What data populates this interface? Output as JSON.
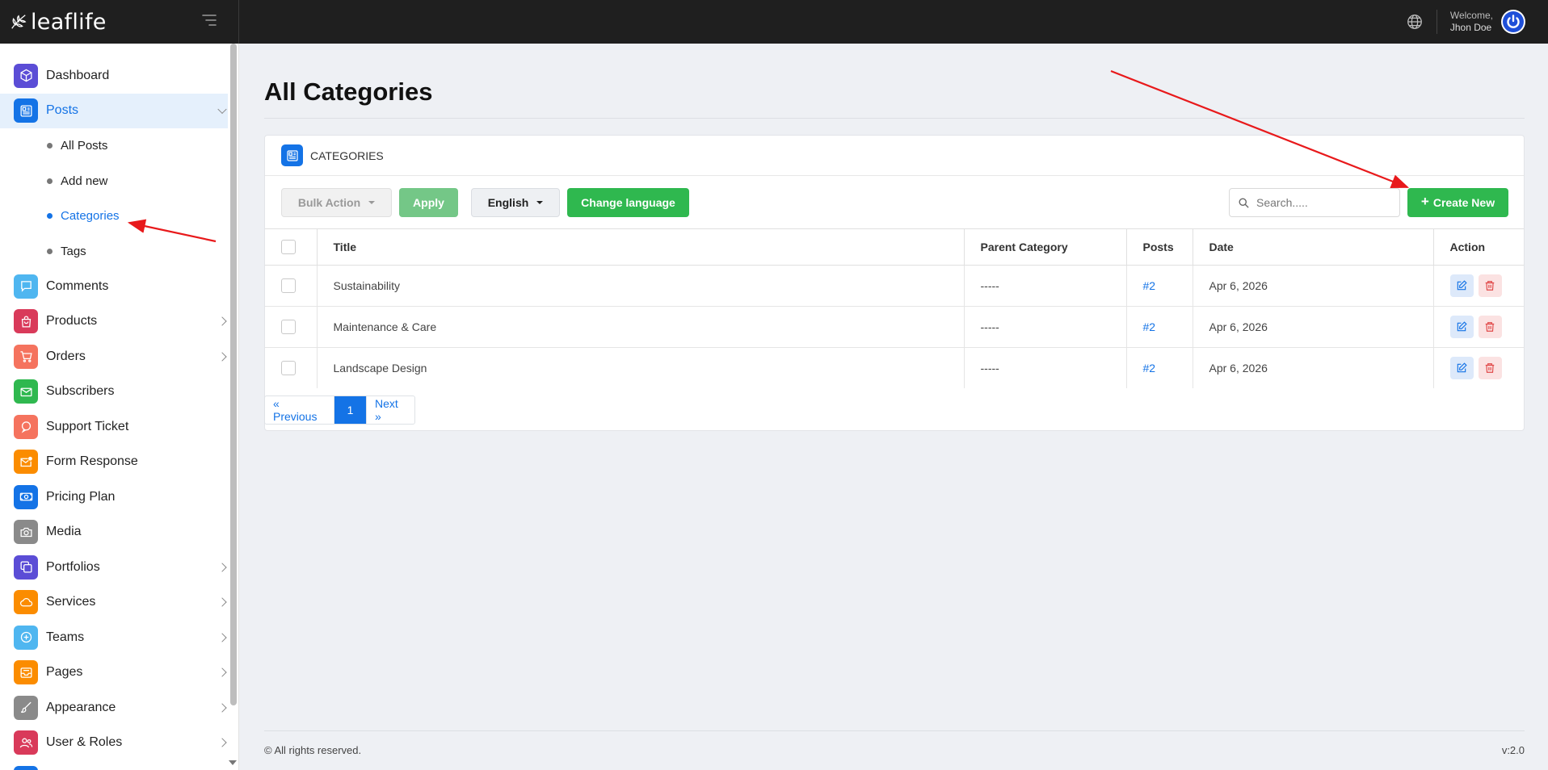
{
  "app": {
    "brand": "leaflife",
    "welcome_label": "Welcome,",
    "user_name": "Jhon Doe"
  },
  "sidebar": {
    "items": [
      {
        "label": "Dashboard",
        "icon": "cube-icon",
        "color": "#5b4dd6"
      },
      {
        "label": "Posts",
        "icon": "newspaper-icon",
        "color": "#1473e6",
        "active": true,
        "expanded": true,
        "children": [
          {
            "label": "All Posts"
          },
          {
            "label": "Add new"
          },
          {
            "label": "Categories",
            "active": true
          },
          {
            "label": "Tags"
          }
        ]
      },
      {
        "label": "Comments",
        "icon": "chat-icon",
        "color": "#4fb6f0"
      },
      {
        "label": "Products",
        "icon": "shopping-bag-icon",
        "color": "#d93a5a",
        "has_children": true
      },
      {
        "label": "Orders",
        "icon": "cart-icon",
        "color": "#f5735e",
        "has_children": true
      },
      {
        "label": "Subscribers",
        "icon": "envelope-icon",
        "color": "#2fb84f"
      },
      {
        "label": "Support Ticket",
        "icon": "support-chat-icon",
        "color": "#f5735e"
      },
      {
        "label": "Form Response",
        "icon": "mail-notification-icon",
        "color": "#fb8c00"
      },
      {
        "label": "Pricing Plan",
        "icon": "money-icon",
        "color": "#1473e6"
      },
      {
        "label": "Media",
        "icon": "camera-icon",
        "color": "#8a8a8a"
      },
      {
        "label": "Portfolios",
        "icon": "copy-icon",
        "color": "#5b4dd6",
        "has_children": true
      },
      {
        "label": "Services",
        "icon": "cloud-icon",
        "color": "#fb8c00",
        "has_children": true
      },
      {
        "label": "Teams",
        "icon": "plus-circle-icon",
        "color": "#4fb6f0",
        "has_children": true
      },
      {
        "label": "Pages",
        "icon": "inbox-icon",
        "color": "#fb8c00",
        "has_children": true
      },
      {
        "label": "Appearance",
        "icon": "brush-icon",
        "color": "#8a8a8a",
        "has_children": true
      },
      {
        "label": "User & Roles",
        "icon": "users-icon",
        "color": "#d93a5a",
        "has_children": true
      }
    ]
  },
  "page": {
    "title": "All Categories",
    "card_title": "CATEGORIES"
  },
  "toolbar": {
    "bulk_action": "Bulk Action",
    "apply": "Apply",
    "language": "English",
    "change_language": "Change language",
    "search_placeholder": "Search.....",
    "create_new": "Create New"
  },
  "table": {
    "headers": [
      "Title",
      "Parent Category",
      "Posts",
      "Date",
      "Action"
    ],
    "rows": [
      {
        "title": "Sustainability",
        "parent": "-----",
        "posts": "#2",
        "date": "Apr 6, 2026"
      },
      {
        "title": "Maintenance & Care",
        "parent": "-----",
        "posts": "#2",
        "date": "Apr 6, 2026"
      },
      {
        "title": "Landscape Design",
        "parent": "-----",
        "posts": "#2",
        "date": "Apr 6, 2026"
      }
    ]
  },
  "pagination": {
    "previous": "« Previous",
    "current": "1",
    "next": "Next »"
  },
  "footer": {
    "copyright": "© All rights reserved.",
    "version": "v:2.0"
  },
  "colors": {
    "accent": "#1473e6",
    "success": "#2fb84f",
    "danger": "#e04848",
    "annotation": "#e8191b"
  }
}
